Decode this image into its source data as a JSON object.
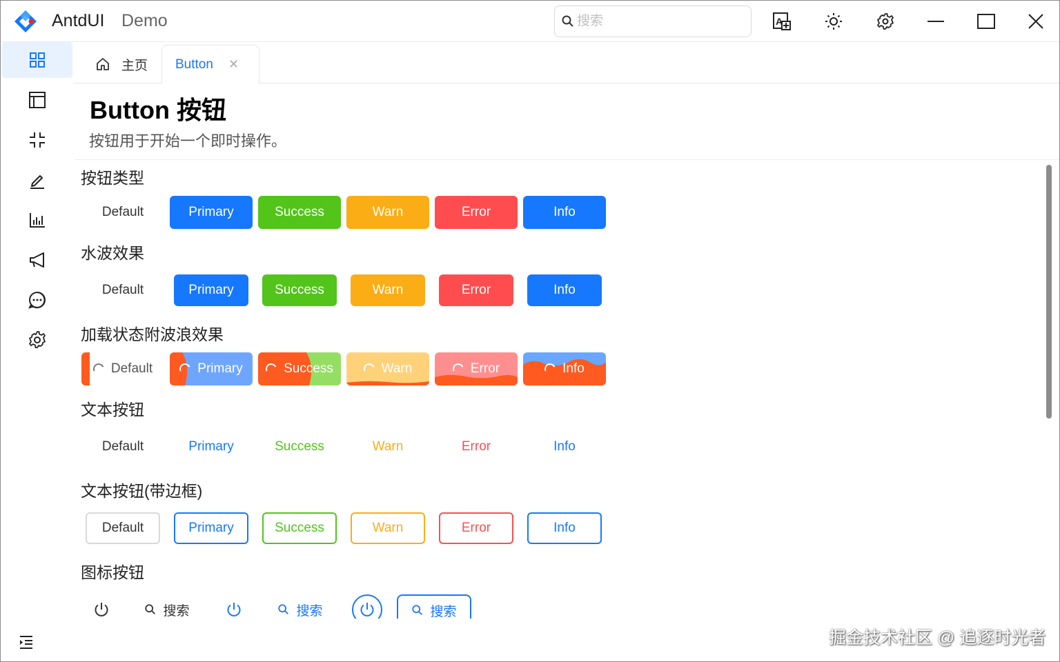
{
  "app": {
    "title": "AntdUI",
    "subtitle": "Demo"
  },
  "search": {
    "placeholder": "搜索"
  },
  "window_controls": [
    "translate-icon",
    "sun-icon",
    "gear-icon",
    "minimize-icon",
    "maximize-icon",
    "close-icon"
  ],
  "sidebar": {
    "items": [
      {
        "icon": "dashboard-grid-icon",
        "active": true
      },
      {
        "icon": "layout-icon",
        "active": false
      },
      {
        "icon": "compress-icon",
        "active": false
      },
      {
        "icon": "edit-icon",
        "active": false
      },
      {
        "icon": "bar-chart-icon",
        "active": false
      },
      {
        "icon": "megaphone-icon",
        "active": false
      },
      {
        "icon": "message-icon",
        "active": false
      },
      {
        "icon": "setting-icon",
        "active": false
      }
    ],
    "collapse_icon": "menu-unfold-icon"
  },
  "tabs": [
    {
      "label": "主页",
      "icon": "home-icon"
    },
    {
      "label": "Button",
      "closable": true,
      "active": true
    }
  ],
  "page": {
    "title": "Button 按钮",
    "description": "按钮用于开始一个即时操作。"
  },
  "sections": [
    {
      "title": "按钮类型",
      "buttons": [
        "Default",
        "Primary",
        "Success",
        "Warn",
        "Error",
        "Info"
      ]
    },
    {
      "title": "水波效果",
      "buttons": [
        "Default",
        "Primary",
        "Success",
        "Warn",
        "Error",
        "Info"
      ]
    },
    {
      "title": "加载状态附波浪效果",
      "buttons": [
        "Default",
        "Primary",
        "Success",
        "Warn",
        "Error",
        "Info"
      ]
    },
    {
      "title": "文本按钮",
      "buttons": [
        "Default",
        "Primary",
        "Success",
        "Warn",
        "Error",
        "Info"
      ]
    },
    {
      "title": "文本按钮(带边框)",
      "buttons": [
        "Default",
        "Primary",
        "Success",
        "Warn",
        "Error",
        "Info"
      ]
    },
    {
      "title": "图标按钮",
      "buttons": [
        "搜索",
        "搜索",
        "搜索"
      ]
    }
  ],
  "colors": {
    "primary": "#1677ff",
    "success": "#52c41a",
    "warn": "#faad14",
    "error": "#ff4d4f",
    "info": "#1677ff",
    "wave": "#ff5a1f"
  },
  "watermark": "掘金技术社区 @ 追逐时光者"
}
